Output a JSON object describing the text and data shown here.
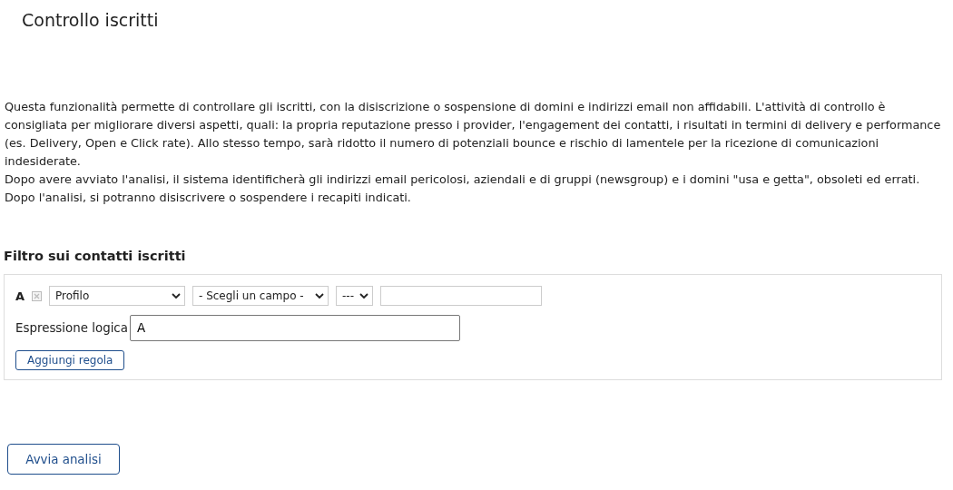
{
  "page": {
    "title": "Controllo iscritti"
  },
  "description": [
    "Questa funzionalità permette di controllare gli iscritti, con la disiscrizione o sospensione di domini e indirizzi email non affidabili. L'attività di controllo è consigliata per migliorare diversi aspetti, quali: la propria reputazione presso i provider, l'engagement dei contatti, i risultati in termini di delivery e performance (es. Delivery, Open e Click rate). Allo stesso tempo, sarà ridotto il numero di potenziali bounce e rischio di lamentele per la ricezione di comunicazioni indesiderate.",
    "Dopo avere avviato l'analisi, il sistema identificherà gli indirizzi email pericolosi, aziendali e di gruppi (newsgroup) e i domini \"usa e getta\", obsoleti ed errati.",
    "Dopo l'analisi, si potranno disiscrivere o sospendere i recapiti indicati."
  ],
  "filter": {
    "heading": "Filtro sui contatti iscritti",
    "rules": [
      {
        "letter": "A",
        "remove_disabled": true,
        "source": "Profilo",
        "field": "- Scegli un campo -",
        "operator": "---"
      }
    ],
    "logic_label": "Espressione logica",
    "logic_value": "A",
    "add_button": "Aggiungi regola"
  },
  "start_button": "Avvia analisi"
}
